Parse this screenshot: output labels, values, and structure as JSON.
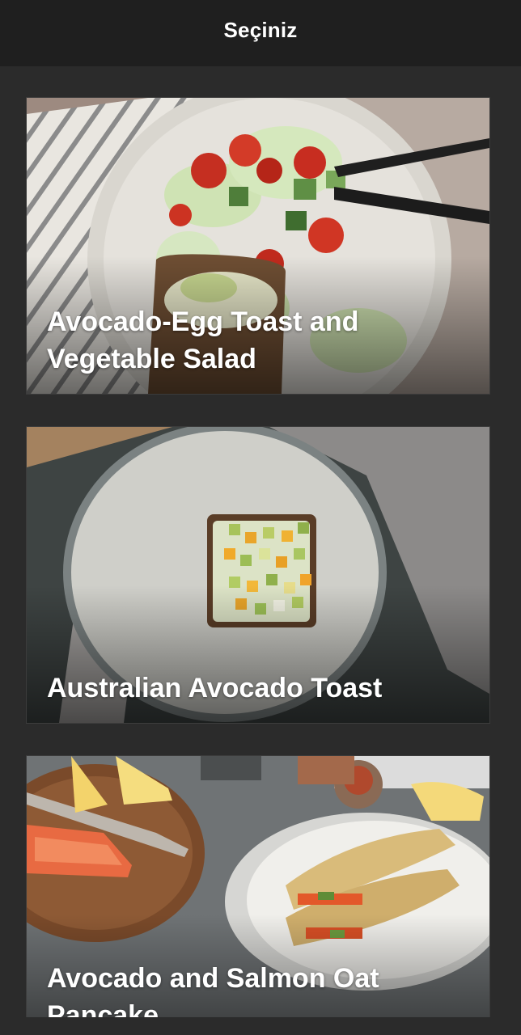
{
  "header": {
    "title": "Seçiniz"
  },
  "recipes": [
    {
      "title": "Avocado-Egg Toast and Vegetable Salad"
    },
    {
      "title": "Australian Avocado Toast"
    },
    {
      "title": "Avocado and Salmon Oat Pancake"
    }
  ],
  "colors": {
    "header_bg": "#1f1f1f",
    "page_bg": "#2b2b2b",
    "text": "#ffffff"
  }
}
